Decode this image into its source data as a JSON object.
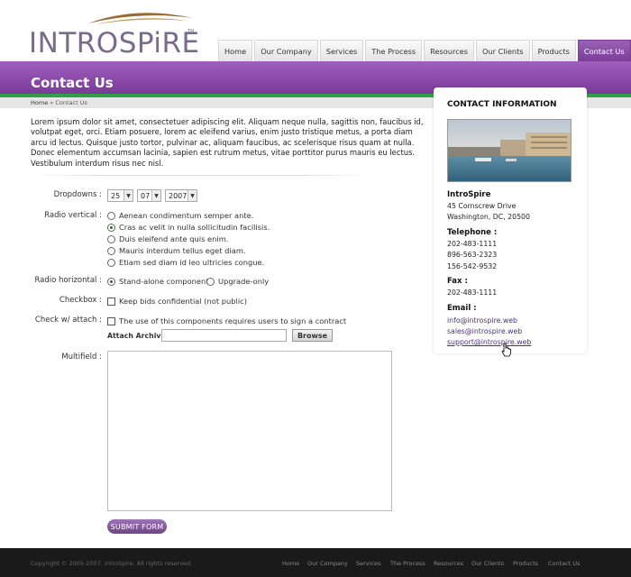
{
  "logo": {
    "text": "INTROSPiRE",
    "tm": "TM"
  },
  "nav": [
    "Home",
    "Our Company",
    "Services",
    "The Process",
    "Resources",
    "Our Clients",
    "Products",
    "Contact Us"
  ],
  "page_title": "Contact Us",
  "breadcrumb": {
    "home": "Home",
    "sep": "»",
    "current": "Contact Us"
  },
  "intro": "Lorem ipsum dolor sit amet, consectetuer adipiscing elit. Aliquam neque nulla, sagittis non, faucibus id, volutpat eget, orci. Etiam posuere, lorem ac eleifend varius, enim justo tristique metus, a porta diam arcu id lectus. Quisque justo tortor, pulvinar ac, aliquam faucibus, ac scelerisque risus quam at nulla. Donec elementum accumsan lacinia, sapien est rutrum metus, vitae porttitor purus mauris eu lectus. Vestibulum interdum risus nec nisl.",
  "form": {
    "dropdowns_label": "Dropdowns :",
    "dropdowns": [
      "25",
      "07",
      "2007"
    ],
    "radio_vertical_label": "Radio vertical :",
    "radio_vertical": [
      {
        "text": "Aenean condimentum semper ante.",
        "checked": false
      },
      {
        "text": "Cras ac velit in nulla sollicitudin facilisis.",
        "checked": true
      },
      {
        "text": "Duis eleifend ante quis enim.",
        "checked": false
      },
      {
        "text": "Mauris interdum tellus eget diam.",
        "checked": false
      },
      {
        "text": "Etiam sed diam id leo ultricies congue.",
        "checked": false
      }
    ],
    "radio_horizontal_label": "Radio horizontal :",
    "radio_horizontal": [
      {
        "text": "Stand-alone component",
        "checked": true
      },
      {
        "text": "Upgrade-only",
        "checked": false
      }
    ],
    "checkbox_label": "Checkbox :",
    "checkbox_text": "Keep bids confidential (not public)",
    "check_attach_label": "Check w/ attach :",
    "check_attach_text": "The use of this components requires users to sign a contract",
    "attach_label": "Attach Archive",
    "attach_value": "",
    "browse_label": "Browse",
    "multifield_label": "Multifield :",
    "multifield_value": "",
    "submit_label": "SUBMIT FORM"
  },
  "sidebar": {
    "heading": "CONTACT INFORMATION",
    "company": "IntroSpire",
    "address1": "45 Cornscrew Drive",
    "address2": "Washington, DC, 20500",
    "telephone_label": "Telephone :",
    "phones": [
      "202-483-1111",
      "896-563-2323",
      "156-542-9532"
    ],
    "fax_label": "Fax :",
    "fax": "202-483-1111",
    "email_label": "Email :",
    "emails": [
      "info@introspire.web",
      "sales@introspire.web",
      "support@introspire.web"
    ]
  },
  "footer": {
    "copyright": "Copyright © 2005-2007. IntroSpire. All rights reserved.",
    "nav": [
      "Home",
      "Our Company",
      "Services",
      "The Process",
      "Resources",
      "Our Clients",
      "Products",
      "Contact Us"
    ]
  },
  "colors": {
    "brand_purple": "#8b4aa8",
    "accent_green": "#2f9e45",
    "footer_bg": "#1a1a1a"
  }
}
